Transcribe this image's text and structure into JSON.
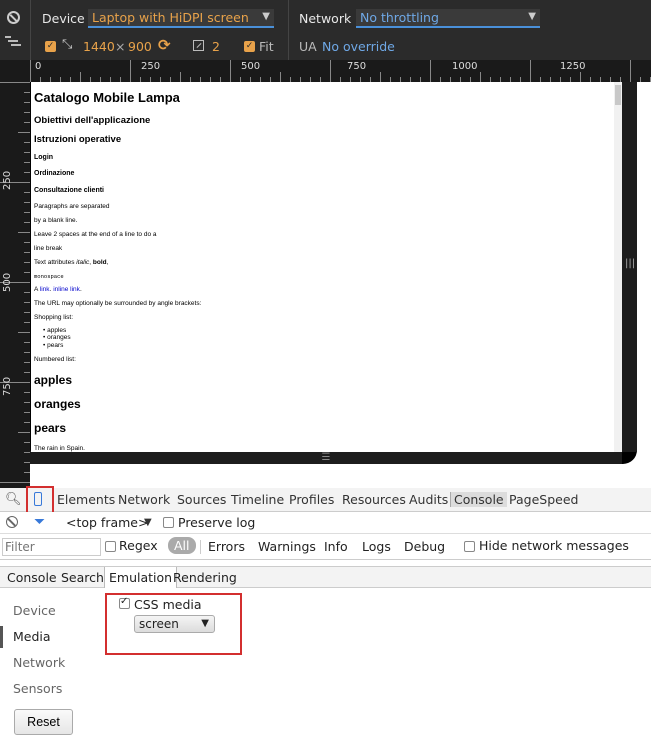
{
  "emulation": {
    "device_label": "Device",
    "device_value": "Laptop with HiDPI screen",
    "network_label": "Network",
    "network_value": "No throttling",
    "width": "1440",
    "times": "×",
    "height": "900",
    "dpr": "2",
    "fit_label": "Fit",
    "ua_label": "UA",
    "ua_value": "No override"
  },
  "ruler": {
    "h_labels": [
      "0",
      "250",
      "500",
      "750",
      "1000",
      "1250"
    ],
    "v_labels": [
      "250",
      "500",
      "750"
    ]
  },
  "page": {
    "title": "Catalogo Mobile Lampa",
    "h2_1": "Obiettivi dell'applicazione",
    "h2_2": "Istruzioni operative",
    "h4_1": "Login",
    "h4_2": "Ordinazione",
    "h4_3": "Consultazione clienti",
    "p1": "Paragraphs are separated",
    "p2": "by a blank line.",
    "p3": "Leave 2 spaces at the end of a line to do a",
    "p4": "line break",
    "p5a": "Text attributes ",
    "p5b": "italic",
    "p5c": ", ",
    "p5d": "bold",
    "p5e": ",",
    "p6": "monospace",
    "p7a": "A ",
    "p7b": "link",
    "p7c": ". ",
    "p7d": "inline link",
    "p7e": ".",
    "p8": "The URL may optionally be surrounded by angle brackets:",
    "p9": "Shopping list:",
    "list": [
      "apples",
      "oranges",
      "pears"
    ],
    "p10": "Numbered list:",
    "n1": "apples",
    "n2": "oranges",
    "n3": "pears",
    "p11": "The rain in Spain."
  },
  "devtools": {
    "tabs": [
      "Elements",
      "Network",
      "Sources",
      "Timeline",
      "Profiles",
      "Resources",
      "Audits",
      "Console",
      "PageSpeed"
    ],
    "frame": "<top frame>",
    "preserve_log": "Preserve log",
    "filter_placeholder": "Filter",
    "regex": "Regex",
    "levels": [
      "All",
      "Errors",
      "Warnings",
      "Info",
      "Logs",
      "Debug"
    ],
    "hide_network": "Hide network messages",
    "drawer_tabs": [
      "Console",
      "Search",
      "Emulation",
      "Rendering"
    ],
    "side_items": [
      "Device",
      "Media",
      "Network",
      "Sensors"
    ],
    "css_media_label": "CSS media",
    "css_media_value": "screen",
    "reset": "Reset"
  }
}
